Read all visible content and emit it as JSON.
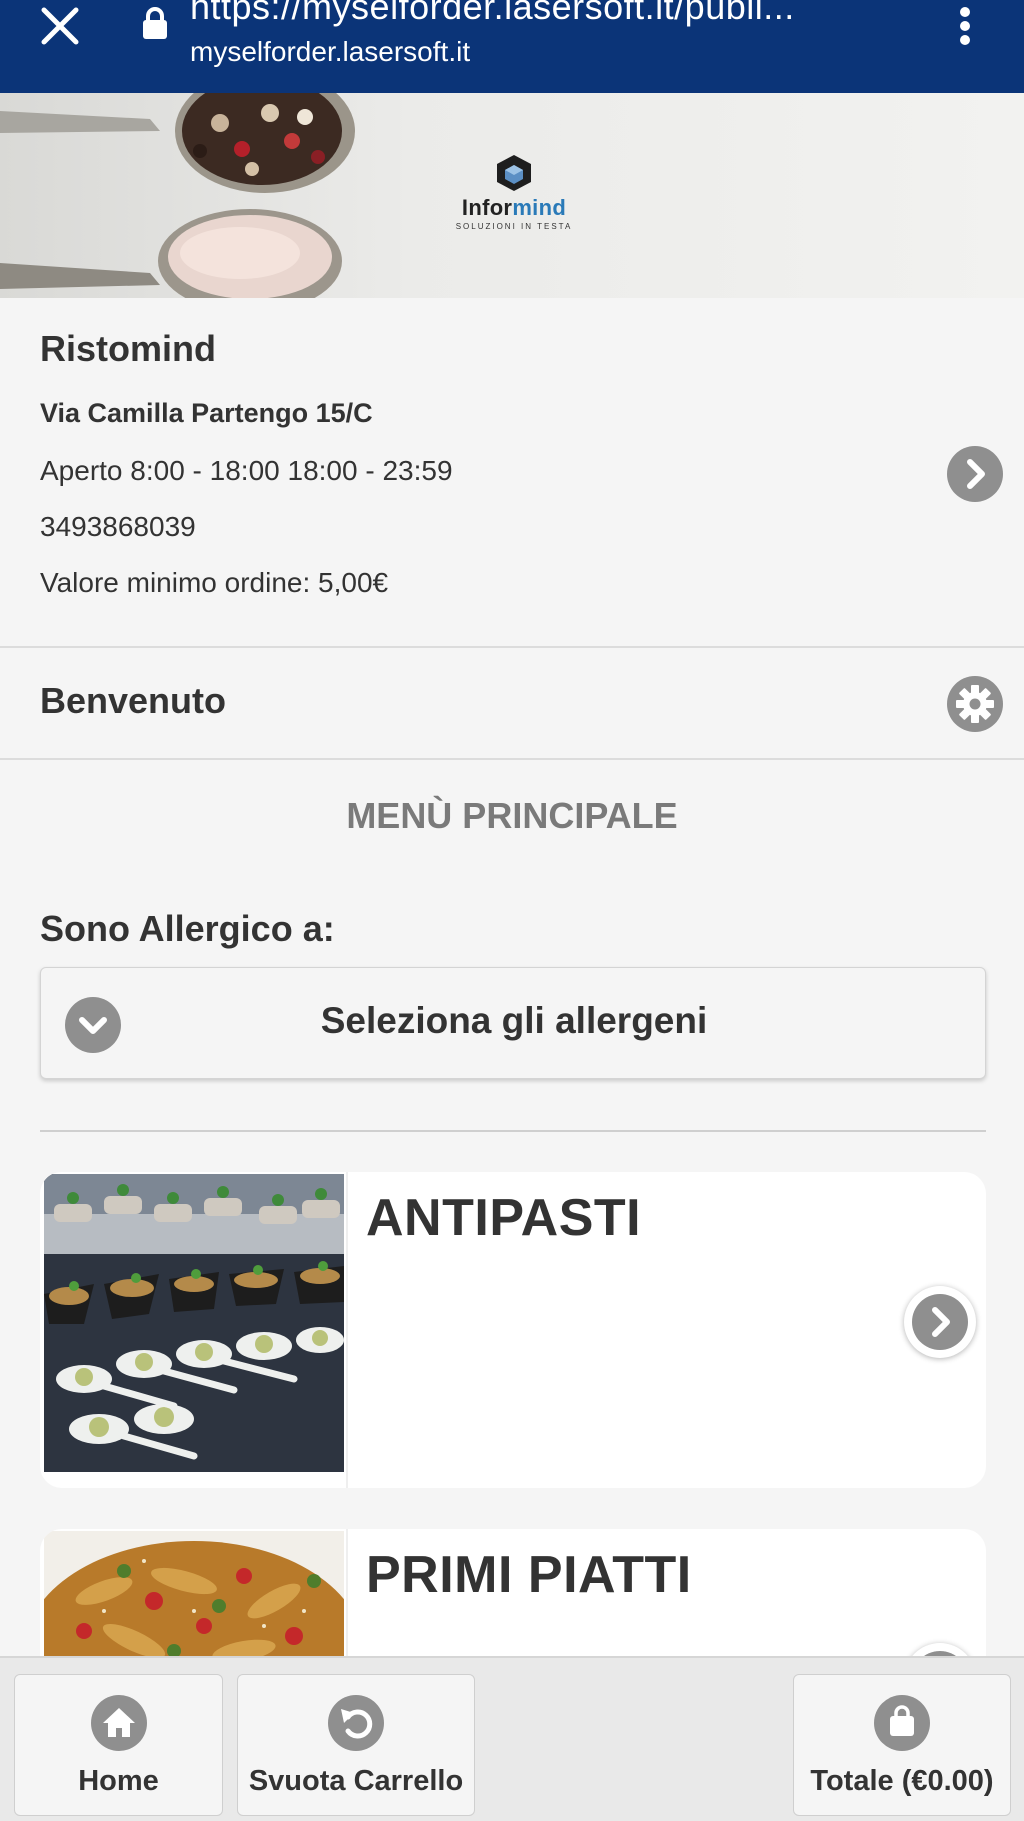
{
  "browser": {
    "url": "https://myselforder.lasersoft.it/publi...",
    "domain": "myselforder.lasersoft.it"
  },
  "banner": {
    "logo_text_a": "Infor",
    "logo_text_b": "mind",
    "logo_sub": "SOLUZIONI IN TESTA"
  },
  "restaurant": {
    "name": "Ristomind",
    "address": "Via Camilla Partengo 15/C",
    "hours": "Aperto 8:00 - 18:00 18:00 - 23:59",
    "phone": "3493868039",
    "min_order": "Valore minimo ordine: 5,00€"
  },
  "welcome": {
    "text": "Benvenuto"
  },
  "menu": {
    "title": "MENÙ PRINCIPALE"
  },
  "allergens": {
    "label": "Sono Allergico a:",
    "select_text": "Seleziona gli allergeni"
  },
  "categories": [
    {
      "title": "ANTIPASTI"
    },
    {
      "title": "PRIMI PIATTI"
    }
  ],
  "bottom_bar": {
    "home": "Home",
    "clear_cart": "Svuota Carrello",
    "total": "Totale (€0.00)"
  },
  "colors": {
    "browser_bar": "#0b3478",
    "icon_gray": "#8f8f8f",
    "text": "#333333",
    "menu_title": "#7a7a7a"
  },
  "icons": [
    "close-icon",
    "lock-icon",
    "more-vert-icon",
    "chevron-right-icon",
    "gear-icon",
    "chevron-down-icon",
    "home-icon",
    "undo-icon",
    "shopping-bag-icon"
  ]
}
